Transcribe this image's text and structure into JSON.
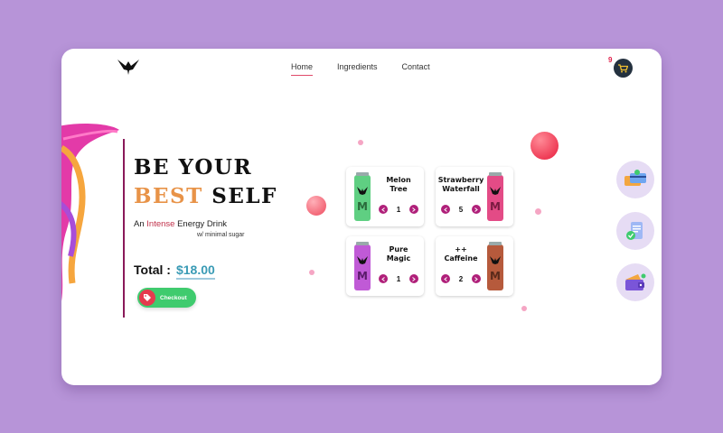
{
  "nav": {
    "items": [
      "Home",
      "Ingredients",
      "Contact"
    ],
    "active": 0
  },
  "cart": {
    "count": "9",
    "icon": "cart-icon"
  },
  "hero": {
    "line1": "BE YOUR",
    "line2_accent": "BEST",
    "line2_rest": " SELF",
    "sub_prefix": "An ",
    "sub_accent": "Intense",
    "sub_suffix": " Energy Drink",
    "minimal": "w/ minimal sugar"
  },
  "total": {
    "label": "Total :",
    "amount": "$18.00"
  },
  "checkout": {
    "label": "Checkout",
    "icon": "tag-icon"
  },
  "products": [
    {
      "name_line1": "Melon",
      "name_line2": "Tree",
      "qty": "1",
      "bg": "#a9ecac",
      "can": "#5fcf82"
    },
    {
      "name_line1": "Strawberry",
      "name_line2": "Waterfall",
      "qty": "5",
      "bg": "#f4b2de",
      "can": "#e34b86"
    },
    {
      "name_line1": "Pure",
      "name_line2": "Magic",
      "qty": "1",
      "bg": "#c9a9ef",
      "can": "#c05ad6"
    },
    {
      "name_line1": "++",
      "name_line2": "Caffeine",
      "qty": "2",
      "bg": "#f6cfb1",
      "can": "#b65a3c"
    }
  ],
  "side_icons": [
    "payment-cards-icon",
    "receipt-icon",
    "wallet-icon"
  ],
  "colors": {
    "background": "#b794d8",
    "accent_orange": "#e89348",
    "total_blue": "#3a9bb5",
    "checkout_green": "#3fcb6e"
  }
}
